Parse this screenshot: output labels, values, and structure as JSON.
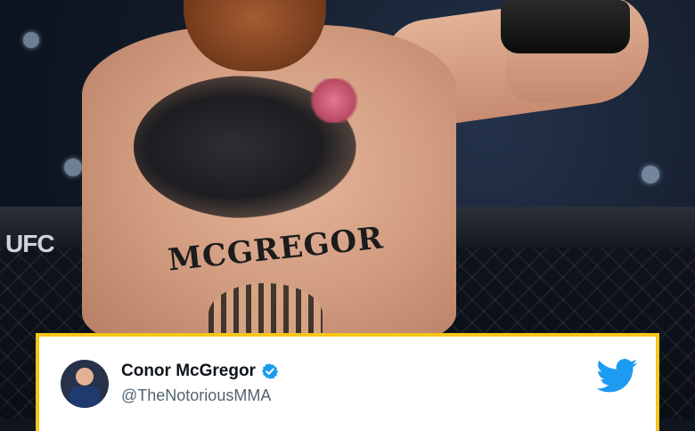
{
  "photo": {
    "alt": "Shirtless fighter with chest tattoos raising a gloved fist in the octagon",
    "tattoo_text": "MCGREGOR",
    "cage_logo": "UFC"
  },
  "tweet": {
    "display_name": "Conor McGregor",
    "handle": "@TheNotoriousMMA",
    "verified": true,
    "border_color": "#f5c518",
    "brand_color": "#1d9bf0"
  },
  "icons": {
    "verified": "verified-badge-icon",
    "twitter": "twitter-bird-icon"
  }
}
